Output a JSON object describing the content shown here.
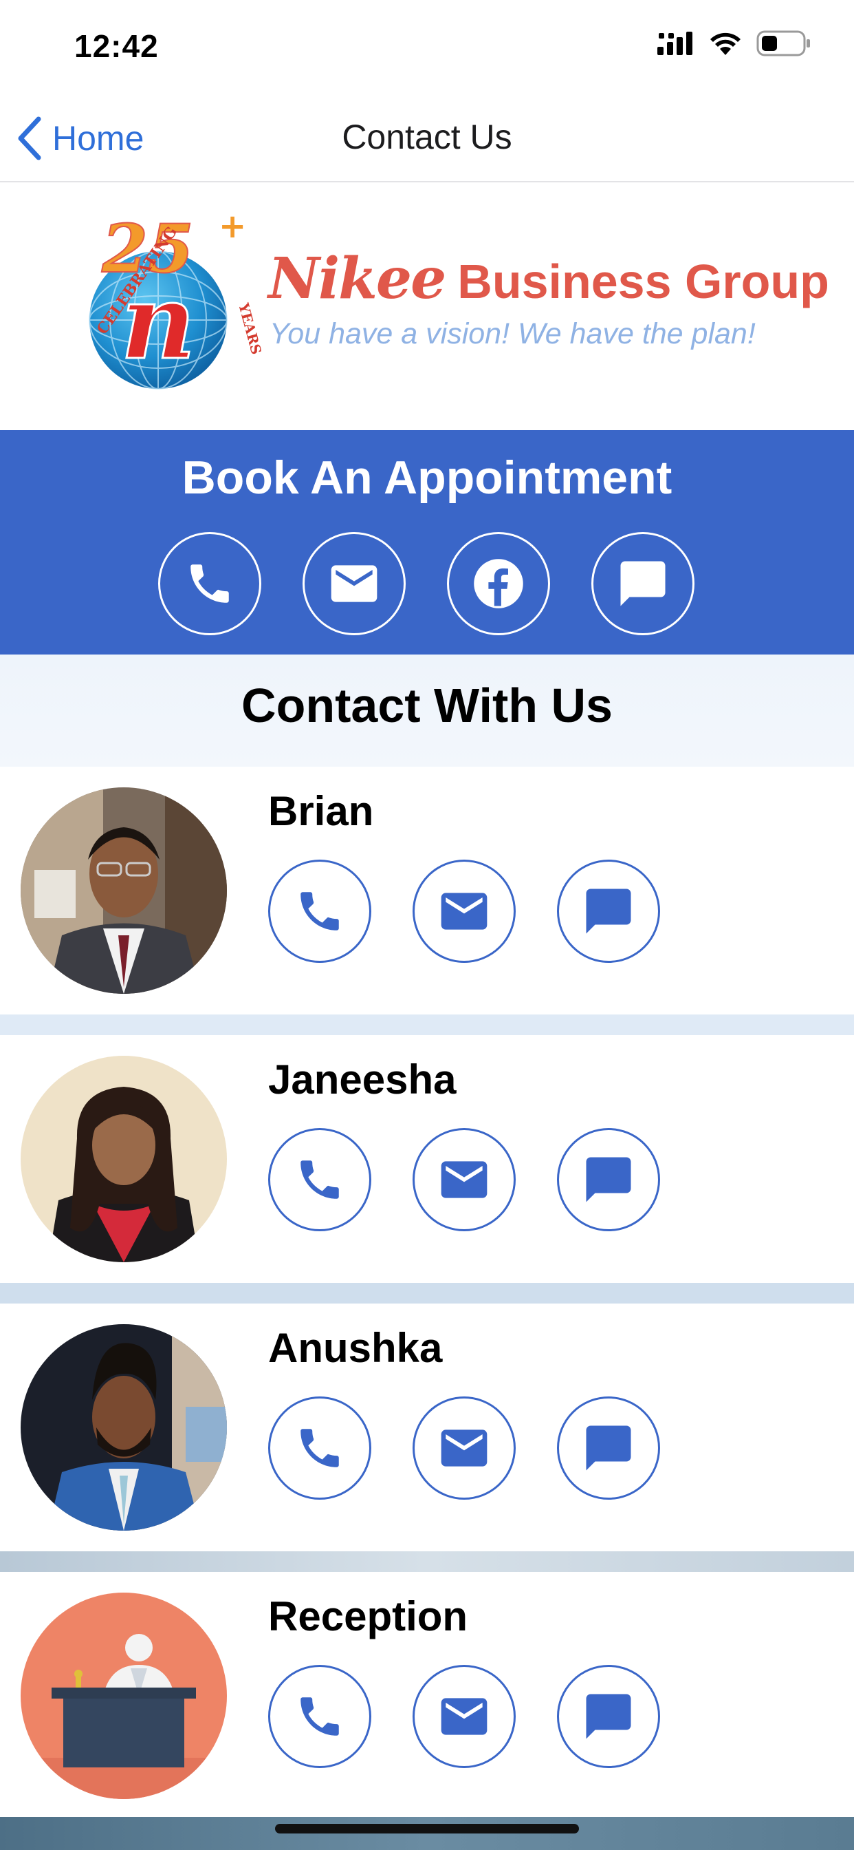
{
  "status_bar": {
    "time": "12:42"
  },
  "nav": {
    "back_label": "Home",
    "title": "Contact Us"
  },
  "brand": {
    "logo_celebrating": "CELEBRATING",
    "logo_number": "25",
    "logo_plus": "+",
    "logo_years": "YEARS",
    "logo_letter": "n",
    "name_script": "Nikee",
    "name_rest": "Business Group",
    "tagline": "You have a vision! We have the plan!"
  },
  "appointment": {
    "title": "Book An Appointment",
    "buttons": [
      "phone-icon",
      "mail-icon",
      "facebook-icon",
      "chat-icon"
    ]
  },
  "contact_heading": "Contact With Us",
  "contacts": [
    {
      "name": "Brian"
    },
    {
      "name": "Janeesha"
    },
    {
      "name": "Anushka"
    },
    {
      "name": "Reception"
    }
  ],
  "colors": {
    "accent_blue": "#3a66c8",
    "brand_red": "#e0584a",
    "tagline_blue": "#8fb2e4",
    "ios_link": "#2f6fd9"
  }
}
